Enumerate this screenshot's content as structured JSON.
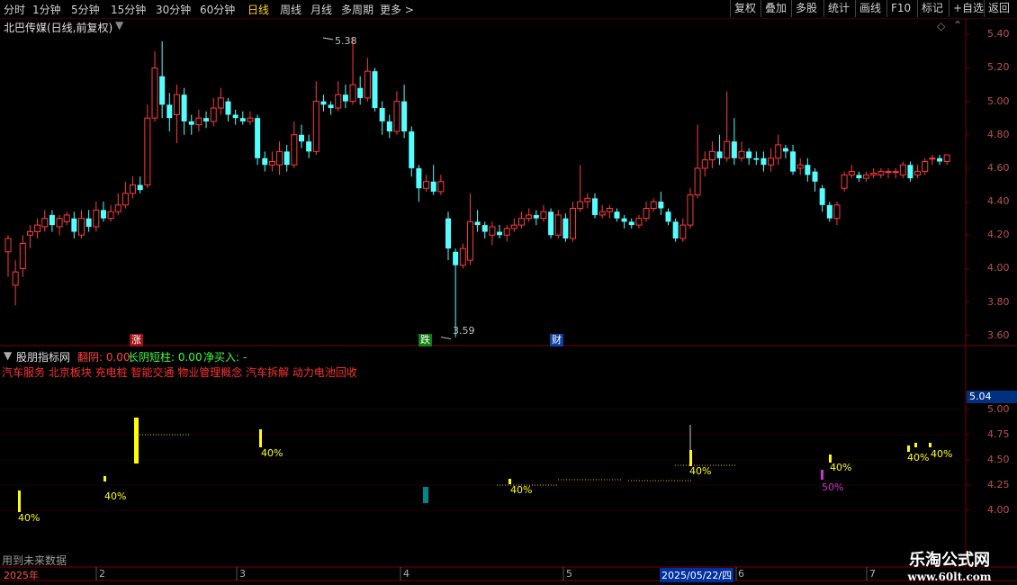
{
  "toolbar": {
    "periods": [
      "分时",
      "1分钟",
      "5分钟",
      "15分钟",
      "30分钟",
      "60分钟",
      "日线",
      "周线",
      "月线",
      "多周期",
      "更多 >"
    ],
    "active": "日线",
    "right": [
      "复权",
      "叠加",
      "多股",
      "统计",
      "画线",
      "F10",
      "标记",
      "+自选",
      "返回"
    ]
  },
  "stock": {
    "title": "北巴传媒(日线,前复权)"
  },
  "price_axis": {
    "ticks": [
      "5.40",
      "5.20",
      "5.00",
      "4.80",
      "4.60",
      "4.40",
      "4.20",
      "4.00",
      "3.80",
      "3.60"
    ]
  },
  "annotations": {
    "high": "5.38",
    "low": "3.59"
  },
  "markers": {
    "up": "涨",
    "down": "跌",
    "fin": "财"
  },
  "indicator": {
    "name": "股朋指标网",
    "items": [
      {
        "label": "翻阴: 0.00",
        "color": "#ff4040"
      },
      {
        "label": "长阴短柱: 0.00",
        "color": "#3cff3c"
      },
      {
        "label": "净买入: -",
        "color": "#3cff3c"
      }
    ],
    "concepts": "汽车服务 北京板块 充电桩 智能交通 物业管理概念 汽车拆解 动力电池回收",
    "current_value": "5.04",
    "axis": [
      "5.00",
      "4.75",
      "4.50",
      "4.25",
      "4.00"
    ],
    "pct_labels": [
      "40%",
      "40%",
      "40%",
      "40%",
      "40%",
      "40%",
      "50%",
      "40%",
      "40%"
    ],
    "footer": "用到未来数据"
  },
  "xaxis": {
    "labels": [
      "2025年",
      "2",
      "3",
      "4",
      "5",
      "2025/05/22/四",
      "6",
      "7"
    ]
  },
  "watermark": {
    "line1": "乐淘公式网",
    "line2": "www.60lt.com"
  },
  "colors": {
    "up": "#ff3b3b",
    "down": "#54ffff",
    "grid": "#7a0000",
    "yellow": "#ffff00"
  },
  "chart_data": {
    "type": "candlestick",
    "ylim": [
      3.55,
      5.45
    ],
    "candles": [
      [
        4.1,
        4.18,
        4.2,
        3.95
      ],
      [
        3.9,
        3.98,
        4.05,
        3.78
      ],
      [
        4.0,
        4.15,
        4.2,
        3.95
      ],
      [
        4.2,
        4.22,
        4.26,
        4.12
      ],
      [
        4.22,
        4.26,
        4.3,
        4.18
      ],
      [
        4.25,
        4.3,
        4.35,
        4.22
      ],
      [
        4.32,
        4.26,
        4.35,
        4.22
      ],
      [
        4.25,
        4.3,
        4.32,
        4.2
      ],
      [
        4.28,
        4.32,
        4.34,
        4.26
      ],
      [
        4.3,
        4.22,
        4.34,
        4.18
      ],
      [
        4.2,
        4.3,
        4.35,
        4.18
      ],
      [
        4.3,
        4.25,
        4.35,
        4.22
      ],
      [
        4.25,
        4.35,
        4.4,
        4.22
      ],
      [
        4.35,
        4.3,
        4.4,
        4.28
      ],
      [
        4.3,
        4.34,
        4.38,
        4.28
      ],
      [
        4.34,
        4.38,
        4.45,
        4.32
      ],
      [
        4.38,
        4.45,
        4.52,
        4.36
      ],
      [
        4.45,
        4.5,
        4.55,
        4.42
      ],
      [
        4.5,
        4.47,
        4.55,
        4.45
      ],
      [
        4.5,
        4.9,
        4.98,
        4.48
      ],
      [
        4.9,
        5.2,
        5.3,
        4.88
      ],
      [
        5.15,
        4.98,
        5.36,
        4.9
      ],
      [
        4.98,
        4.9,
        5.05,
        4.82
      ],
      [
        4.92,
        5.04,
        5.1,
        4.75
      ],
      [
        5.04,
        4.88,
        5.08,
        4.8
      ],
      [
        4.88,
        4.86,
        4.92,
        4.8
      ],
      [
        4.86,
        4.9,
        4.95,
        4.82
      ],
      [
        4.9,
        4.88,
        4.94,
        4.84
      ],
      [
        4.88,
        4.96,
        5.02,
        4.85
      ],
      [
        4.96,
        5.02,
        5.08,
        4.92
      ],
      [
        5.0,
        4.92,
        5.02,
        4.88
      ],
      [
        4.92,
        4.9,
        4.95,
        4.86
      ],
      [
        4.9,
        4.88,
        4.94,
        4.86
      ],
      [
        4.88,
        4.9,
        4.94,
        4.86
      ],
      [
        4.9,
        4.66,
        4.92,
        4.62
      ],
      [
        4.66,
        4.62,
        4.7,
        4.58
      ],
      [
        4.62,
        4.64,
        4.7,
        4.58
      ],
      [
        4.62,
        4.7,
        4.76,
        4.56
      ],
      [
        4.7,
        4.62,
        4.74,
        4.58
      ],
      [
        4.62,
        4.8,
        4.88,
        4.6
      ],
      [
        4.8,
        4.76,
        4.86,
        4.72
      ],
      [
        4.76,
        4.7,
        4.8,
        4.66
      ],
      [
        4.7,
        5.0,
        5.12,
        4.68
      ],
      [
        5.0,
        4.98,
        5.04,
        4.94
      ],
      [
        4.98,
        4.96,
        5.0,
        4.92
      ],
      [
        4.96,
        5.04,
        5.12,
        4.94
      ],
      [
        5.04,
        5.0,
        5.1,
        4.96
      ],
      [
        5.0,
        5.1,
        5.38,
        4.98
      ],
      [
        5.08,
        5.02,
        5.15,
        4.98
      ],
      [
        5.02,
        5.18,
        5.26,
        5.0
      ],
      [
        5.18,
        4.96,
        5.2,
        4.94
      ],
      [
        4.96,
        4.88,
        5.0,
        4.8
      ],
      [
        4.88,
        4.82,
        4.92,
        4.78
      ],
      [
        4.82,
        5.0,
        5.06,
        4.8
      ],
      [
        5.0,
        4.82,
        5.1,
        4.78
      ],
      [
        4.82,
        4.6,
        4.85,
        4.55
      ],
      [
        4.6,
        4.48,
        4.62,
        4.4
      ],
      [
        4.48,
        4.52,
        4.56,
        4.46
      ],
      [
        4.52,
        4.46,
        4.62,
        4.44
      ],
      [
        4.46,
        4.52,
        4.56,
        4.44
      ],
      [
        4.3,
        4.12,
        4.34,
        4.05
      ],
      [
        4.1,
        4.02,
        4.12,
        3.59
      ],
      [
        4.02,
        4.12,
        4.15,
        4.0
      ],
      [
        4.05,
        4.28,
        4.45,
        4.02
      ],
      [
        4.28,
        4.26,
        4.35,
        4.22
      ],
      [
        4.26,
        4.22,
        4.28,
        4.18
      ],
      [
        4.2,
        4.25,
        4.28,
        4.14
      ],
      [
        4.22,
        4.2,
        4.26,
        4.18
      ],
      [
        4.2,
        4.24,
        4.26,
        4.16
      ],
      [
        4.24,
        4.26,
        4.3,
        4.22
      ],
      [
        4.26,
        4.3,
        4.34,
        4.24
      ],
      [
        4.3,
        4.32,
        4.36,
        4.28
      ],
      [
        4.32,
        4.3,
        4.35,
        4.26
      ],
      [
        4.3,
        4.34,
        4.38,
        4.28
      ],
      [
        4.34,
        4.2,
        4.36,
        4.18
      ],
      [
        4.2,
        4.32,
        4.35,
        4.18
      ],
      [
        4.3,
        4.18,
        4.33,
        4.16
      ],
      [
        4.18,
        4.36,
        4.4,
        4.16
      ],
      [
        4.36,
        4.4,
        4.62,
        4.34
      ],
      [
        4.4,
        4.42,
        4.45,
        4.36
      ],
      [
        4.42,
        4.32,
        4.45,
        4.3
      ],
      [
        4.32,
        4.34,
        4.38,
        4.3
      ],
      [
        4.34,
        4.36,
        4.38,
        4.3
      ],
      [
        4.34,
        4.3,
        4.36,
        4.28
      ],
      [
        4.3,
        4.28,
        4.32,
        4.24
      ],
      [
        4.28,
        4.26,
        4.3,
        4.24
      ],
      [
        4.26,
        4.3,
        4.32,
        4.24
      ],
      [
        4.3,
        4.36,
        4.4,
        4.28
      ],
      [
        4.36,
        4.4,
        4.42,
        4.34
      ],
      [
        4.4,
        4.36,
        4.46,
        4.32
      ],
      [
        4.34,
        4.28,
        4.36,
        4.26
      ],
      [
        4.28,
        4.18,
        4.3,
        4.16
      ],
      [
        4.18,
        4.26,
        4.3,
        4.16
      ],
      [
        4.26,
        4.44,
        4.48,
        4.24
      ],
      [
        4.44,
        4.6,
        4.86,
        4.42
      ],
      [
        4.6,
        4.65,
        4.7,
        4.55
      ],
      [
        4.65,
        4.7,
        4.76,
        4.6
      ],
      [
        4.7,
        4.66,
        4.8,
        4.62
      ],
      [
        4.66,
        4.76,
        5.06,
        4.64
      ],
      [
        4.76,
        4.66,
        4.9,
        4.62
      ],
      [
        4.66,
        4.7,
        4.76,
        4.64
      ],
      [
        4.7,
        4.66,
        4.72,
        4.62
      ],
      [
        4.66,
        4.65,
        4.7,
        4.62
      ],
      [
        4.66,
        4.62,
        4.7,
        4.58
      ],
      [
        4.62,
        4.66,
        4.72,
        4.58
      ],
      [
        4.66,
        4.74,
        4.8,
        4.62
      ],
      [
        4.72,
        4.7,
        4.74,
        4.66
      ],
      [
        4.7,
        4.58,
        4.74,
        4.56
      ],
      [
        4.6,
        4.62,
        4.66,
        4.56
      ],
      [
        4.62,
        4.56,
        4.66,
        4.52
      ],
      [
        4.58,
        4.52,
        4.6,
        4.46
      ],
      [
        4.48,
        4.38,
        4.5,
        4.34
      ],
      [
        4.38,
        4.3,
        4.4,
        4.28
      ],
      [
        4.3,
        4.38,
        4.4,
        4.26
      ],
      [
        4.48,
        4.56,
        4.58,
        4.46
      ],
      [
        4.56,
        4.58,
        4.62,
        4.54
      ],
      [
        4.56,
        4.54,
        4.58,
        4.52
      ],
      [
        4.54,
        4.56,
        4.58,
        4.52
      ],
      [
        4.56,
        4.57,
        4.6,
        4.54
      ],
      [
        4.56,
        4.58,
        4.6,
        4.54
      ],
      [
        4.58,
        4.58,
        4.6,
        4.54
      ],
      [
        4.58,
        4.58,
        4.6,
        4.54
      ],
      [
        4.56,
        4.62,
        4.64,
        4.54
      ],
      [
        4.62,
        4.54,
        4.64,
        4.52
      ],
      [
        4.56,
        4.58,
        4.62,
        4.54
      ],
      [
        4.58,
        4.64,
        4.66,
        4.56
      ],
      [
        4.66,
        4.66,
        4.68,
        4.62
      ],
      [
        4.66,
        4.64,
        4.68,
        4.62
      ],
      [
        4.64,
        4.68,
        4.68,
        4.62
      ]
    ]
  }
}
